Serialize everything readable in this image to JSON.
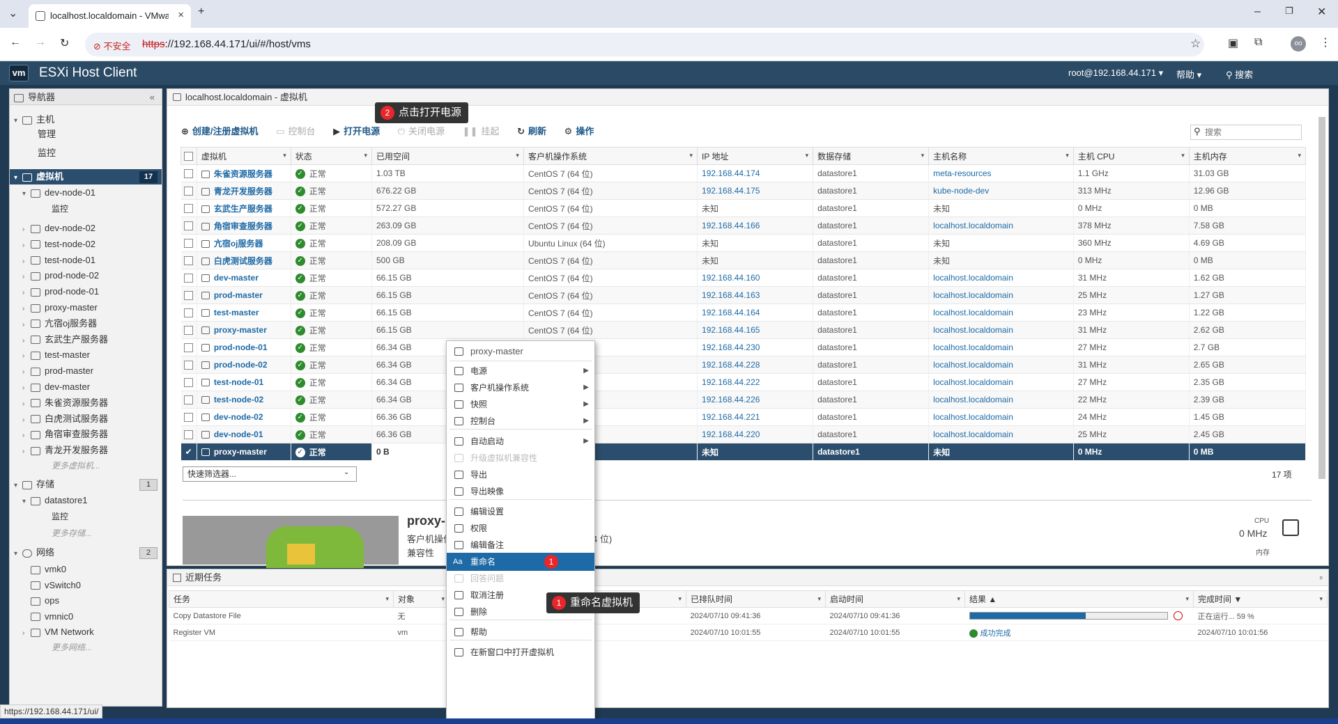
{
  "browser": {
    "tab_title": "localhost.localdomain - VMware",
    "not_secure": "不安全",
    "url_scheme": "https",
    "url_rest": "://192.168.44.171/ui/#/host/vms",
    "status_url": "https://192.168.44.171/ui/",
    "profile": "oo"
  },
  "header": {
    "app_title": "ESXi Host Client",
    "logo": "vm",
    "user": "root@192.168.44.171 ▾",
    "help": "帮助 ▾",
    "search": "搜索"
  },
  "nav": {
    "title": "导航器",
    "host": "主机",
    "manage": "管理",
    "monitor": "监控",
    "vms": "虚拟机",
    "vms_count": "17",
    "dev_node_01": "dev-node-01",
    "dev_node_01_monitor": "监控",
    "vm_items": [
      "dev-node-02",
      "test-node-02",
      "test-node-01",
      "prod-node-02",
      "prod-node-01",
      "proxy-master",
      "亢宿oj服务器",
      "玄武生产服务器",
      "test-master",
      "prod-master",
      "dev-master",
      "朱雀资源服务器",
      "白虎测试服务器",
      "角宿审查服务器",
      "青龙开发服务器"
    ],
    "more_vms": "更多虚拟机...",
    "storage": "存储",
    "storage_count": "1",
    "datastore": "datastore1",
    "ds_monitor": "监控",
    "more_storage": "更多存储...",
    "network": "网络",
    "network_count": "2",
    "net_items": [
      "vmk0",
      "vSwitch0",
      "ops",
      "vmnic0",
      "VM Network"
    ],
    "more_network": "更多网络..."
  },
  "main": {
    "breadcrumb": "localhost.localdomain - 虚拟机",
    "toolbar": {
      "create": "创建/注册虚拟机",
      "console": "控制台",
      "power_on": "打开电源",
      "power_off": "关闭电源",
      "suspend": "挂起",
      "refresh": "刷新",
      "actions": "操作"
    },
    "search_placeholder": "搜索",
    "columns": [
      "虚拟机",
      "状态",
      "已用空间",
      "客户机操作系统",
      "IP 地址",
      "数据存储",
      "主机名称",
      "主机 CPU",
      "主机内存"
    ],
    "rows": [
      [
        "朱雀资源服务器",
        "正常",
        "1.03 TB",
        "CentOS 7 (64 位)",
        "192.168.44.174",
        "datastore1",
        "meta-resources",
        "1.1 GHz",
        "31.03 GB"
      ],
      [
        "青龙开发服务器",
        "正常",
        "676.22 GB",
        "CentOS 7 (64 位)",
        "192.168.44.175",
        "datastore1",
        "kube-node-dev",
        "313 MHz",
        "12.96 GB"
      ],
      [
        "玄武生产服务器",
        "正常",
        "572.27 GB",
        "CentOS 7 (64 位)",
        "未知",
        "datastore1",
        "未知",
        "0 MHz",
        "0 MB"
      ],
      [
        "角宿审查服务器",
        "正常",
        "263.09 GB",
        "CentOS 7 (64 位)",
        "192.168.44.166",
        "datastore1",
        "localhost.localdomain",
        "378 MHz",
        "7.58 GB"
      ],
      [
        "亢宿oj服务器",
        "正常",
        "208.09 GB",
        "Ubuntu Linux (64 位)",
        "未知",
        "datastore1",
        "未知",
        "360 MHz",
        "4.69 GB"
      ],
      [
        "白虎测试服务器",
        "正常",
        "500 GB",
        "CentOS 7 (64 位)",
        "未知",
        "datastore1",
        "未知",
        "0 MHz",
        "0 MB"
      ],
      [
        "dev-master",
        "正常",
        "66.15 GB",
        "CentOS 7 (64 位)",
        "192.168.44.160",
        "datastore1",
        "localhost.localdomain",
        "31 MHz",
        "1.62 GB"
      ],
      [
        "prod-master",
        "正常",
        "66.15 GB",
        "CentOS 7 (64 位)",
        "192.168.44.163",
        "datastore1",
        "localhost.localdomain",
        "25 MHz",
        "1.27 GB"
      ],
      [
        "test-master",
        "正常",
        "66.15 GB",
        "CentOS 7 (64 位)",
        "192.168.44.164",
        "datastore1",
        "localhost.localdomain",
        "23 MHz",
        "1.22 GB"
      ],
      [
        "proxy-master",
        "正常",
        "66.15 GB",
        "CentOS 7 (64 位)",
        "192.168.44.165",
        "datastore1",
        "localhost.localdomain",
        "31 MHz",
        "2.62 GB"
      ],
      [
        "prod-node-01",
        "正常",
        "66.34 GB",
        "",
        "192.168.44.230",
        "datastore1",
        "localhost.localdomain",
        "27 MHz",
        "2.7 GB"
      ],
      [
        "prod-node-02",
        "正常",
        "66.34 GB",
        "",
        "192.168.44.228",
        "datastore1",
        "localhost.localdomain",
        "31 MHz",
        "2.65 GB"
      ],
      [
        "test-node-01",
        "正常",
        "66.34 GB",
        "",
        "192.168.44.222",
        "datastore1",
        "localhost.localdomain",
        "27 MHz",
        "2.35 GB"
      ],
      [
        "test-node-02",
        "正常",
        "66.34 GB",
        "",
        "192.168.44.226",
        "datastore1",
        "localhost.localdomain",
        "22 MHz",
        "2.39 GB"
      ],
      [
        "dev-node-02",
        "正常",
        "66.36 GB",
        "",
        "192.168.44.221",
        "datastore1",
        "localhost.localdomain",
        "24 MHz",
        "1.45 GB"
      ],
      [
        "dev-node-01",
        "正常",
        "66.36 GB",
        "",
        "192.168.44.220",
        "datastore1",
        "localhost.localdomain",
        "25 MHz",
        "2.45 GB"
      ],
      [
        "proxy-master",
        "正常",
        "0 B",
        "",
        "未知",
        "datastore1",
        "未知",
        "0 MHz",
        "0 MB"
      ]
    ],
    "quick_filter": "快速筛选器...",
    "item_count": "17 项",
    "preview": {
      "name": "proxy-",
      "os_label": "客户机操作",
      "os_tail": "4 位)",
      "compat": "兼容性",
      "cpu_label": "CPU",
      "cpu_value": "0 MHz",
      "mem_label": "内存"
    }
  },
  "tasks": {
    "title": "近期任务",
    "columns": [
      "任务",
      "对象",
      "",
      "已排队时间",
      "启动时间",
      "结果 ▲",
      "完成时间 ▼"
    ],
    "rows": [
      {
        "task": "Copy Datastore File",
        "target": "无",
        "queued": "2024/07/10 09:41:36",
        "started": "2024/07/10 09:41:36",
        "result": "",
        "progress": 59,
        "done": "正在运行... 59 %"
      },
      {
        "task": "Register VM",
        "target": "vm",
        "queued": "2024/07/10 10:01:55",
        "started": "2024/07/10 10:01:55",
        "result": "成功完成",
        "progress": null,
        "done": "2024/07/10 10:01:56"
      }
    ]
  },
  "context_menu": {
    "header": "proxy-master",
    "items": [
      "电源",
      "客户机操作系统",
      "快照",
      "控制台",
      "自动启动",
      "升级虚拟机兼容性",
      "导出",
      "导出映像",
      "编辑设置",
      "权限",
      "编辑备注",
      "重命名",
      "回答问题",
      "取消注册",
      "删除",
      "帮助",
      "在新窗口中打开虚拟机"
    ]
  },
  "callouts": {
    "one_num": "1",
    "one_text": "重命名虚拟机",
    "two_num": "2",
    "two_text": "点击打开电源"
  },
  "colors": {
    "header_bg": "#2b4a65",
    "selected_row": "#2c4e6e",
    "link": "#1e6aa6",
    "callout_red": "#e8262c"
  }
}
